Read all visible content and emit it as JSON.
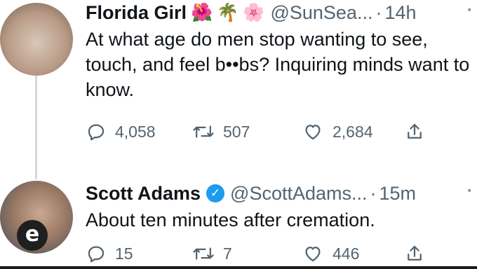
{
  "tweets": [
    {
      "name": "Florida Girl",
      "emojis": [
        "🌺",
        "🌴",
        "🌸"
      ],
      "handle": "@SunSea...",
      "dot": "·",
      "time": "14h",
      "text": "At what age do men stop wanting to see, touch, and feel b••bs? Inquiring minds want to know.",
      "replies": "4,058",
      "retweets": "507",
      "likes": "2,684"
    },
    {
      "name": "Scott Adams",
      "verified": true,
      "handle": "@ScottAdams...",
      "dot": "·",
      "time": "15m",
      "text": "About ten minutes after cremation.",
      "replies": "15",
      "retweets": "7",
      "likes": "446"
    }
  ],
  "avatar_badge": "e",
  "colors": {
    "secondary_text": "#536471",
    "verified_blue": "#1d9bf0",
    "thread_line": "#cfd9de"
  }
}
